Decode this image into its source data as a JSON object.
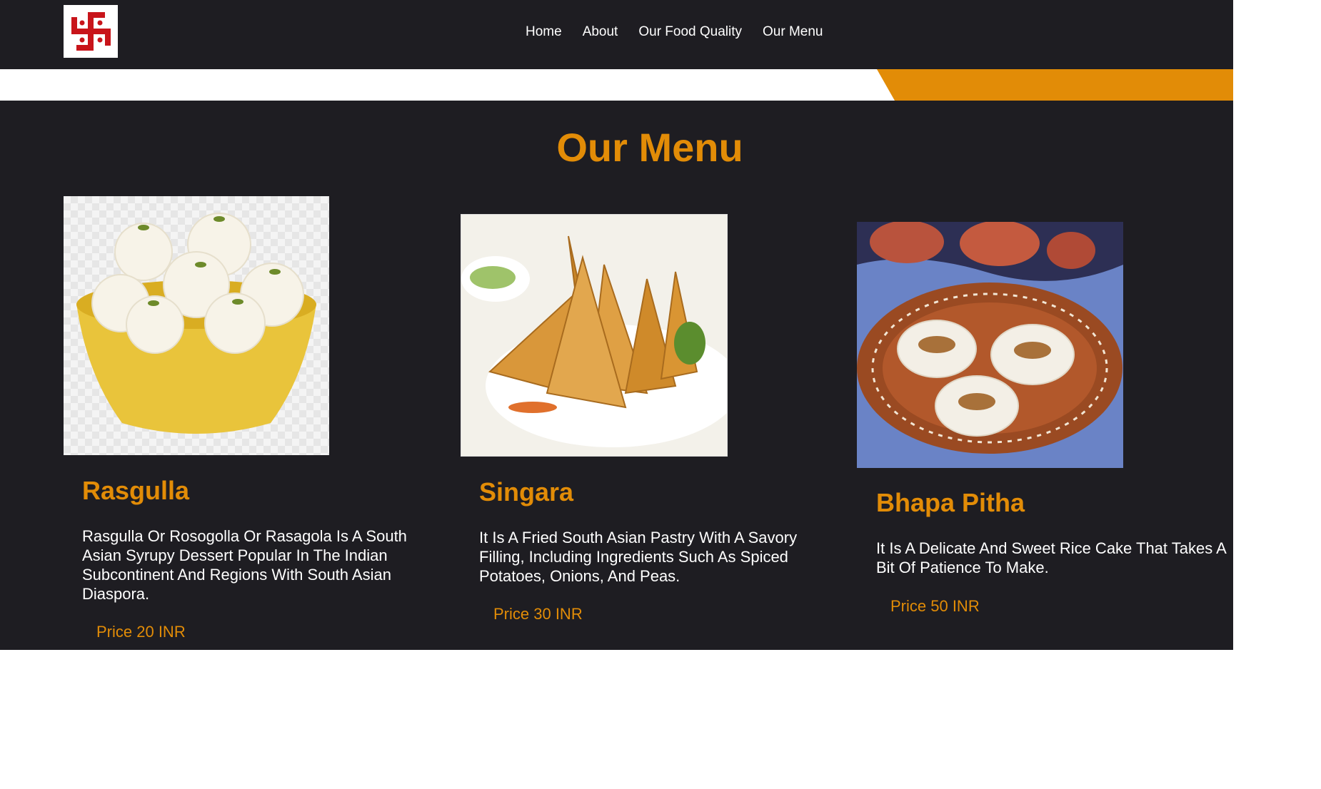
{
  "nav": {
    "items": [
      {
        "label": "Home"
      },
      {
        "label": "About"
      },
      {
        "label": "Our Food Quality"
      },
      {
        "label": "Our Menu"
      }
    ]
  },
  "menu": {
    "title": "Our Menu",
    "items": [
      {
        "name": "Rasgulla",
        "description": "Rasgulla Or Rosogolla Or Rasagola Is A South Asian Syrupy Dessert Popular In The Indian Subcontinent And Regions With South Asian Diaspora.",
        "price": "Price 20 INR"
      },
      {
        "name": "Singara",
        "description": "It Is A Fried South Asian Pastry With A Savory Filling, Including Ingredients Such As Spiced Potatoes, Onions, And Peas.",
        "price": "Price 30 INR"
      },
      {
        "name": "Bhapa Pitha",
        "description": "It Is A Delicate And Sweet Rice Cake That Takes A Bit Of Patience To Make.",
        "price": "Price 50 INR"
      }
    ]
  },
  "colors": {
    "accent": "#e28c07",
    "background_dark": "#1e1d22",
    "text_light": "#ffffff"
  }
}
